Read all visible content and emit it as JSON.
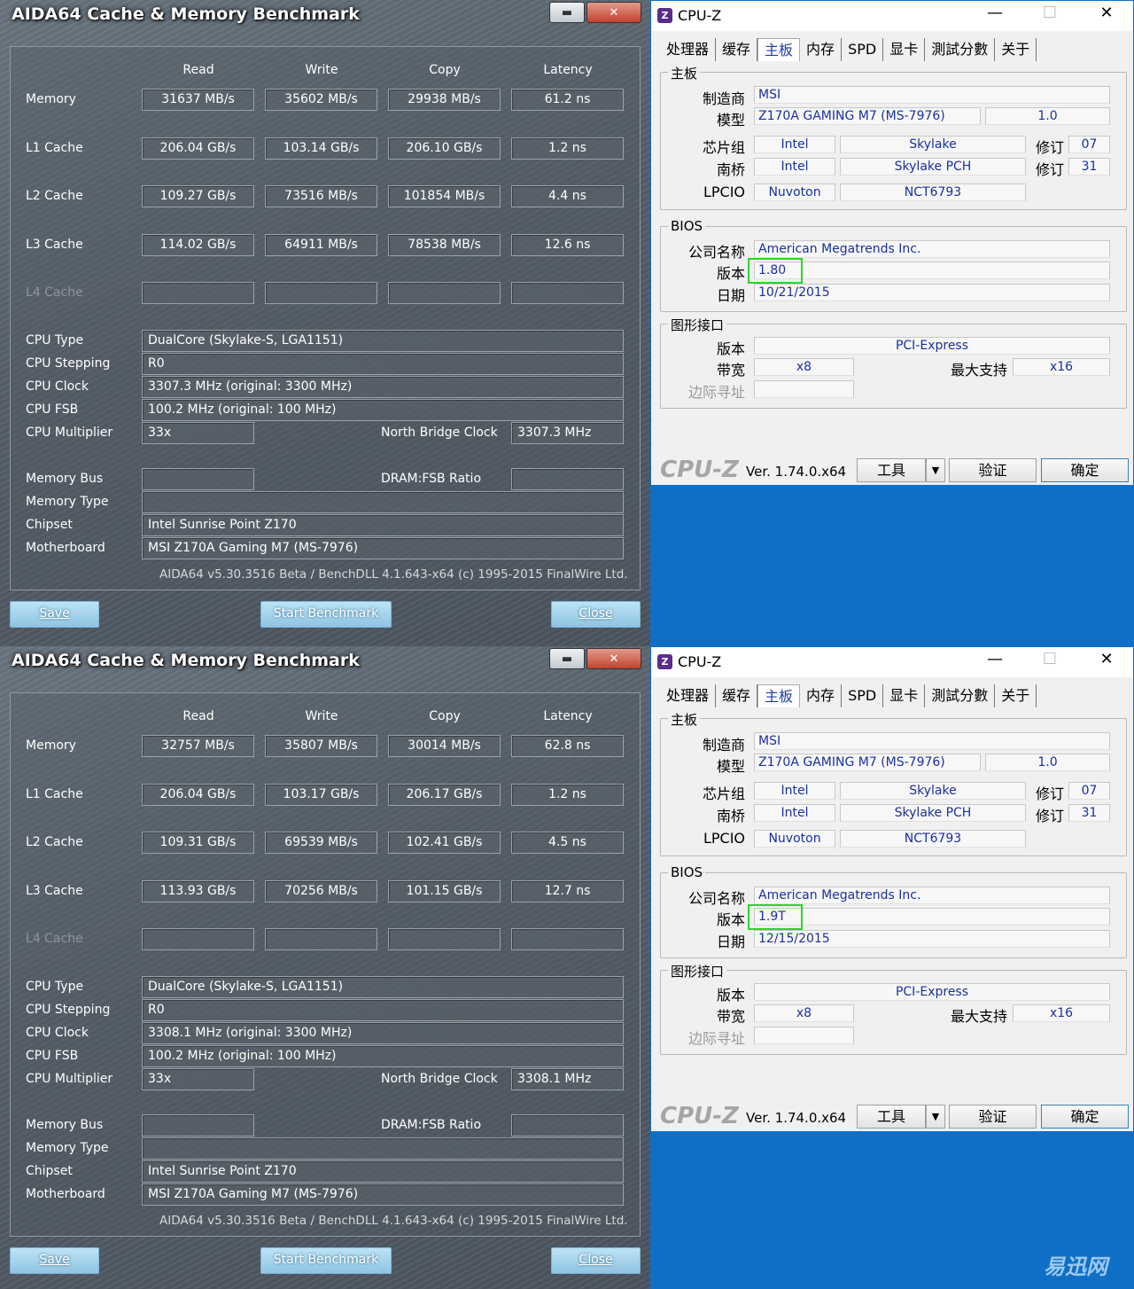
{
  "screens": [
    {
      "aida": {
        "title": "AIDA64 Cache & Memory Benchmark",
        "window_buttons": {
          "minimize": "▬",
          "close": "✕"
        },
        "columns": [
          "Read",
          "Write",
          "Copy",
          "Latency"
        ],
        "rows": [
          {
            "label": "Memory",
            "values": [
              "31637 MB/s",
              "35602 MB/s",
              "29938 MB/s",
              "61.2 ns"
            ]
          },
          {
            "label": "L1 Cache",
            "values": [
              "206.04 GB/s",
              "103.14 GB/s",
              "206.10 GB/s",
              "1.2 ns"
            ]
          },
          {
            "label": "L2 Cache",
            "values": [
              "109.27 GB/s",
              "73516 MB/s",
              "101854 MB/s",
              "4.4 ns"
            ]
          },
          {
            "label": "L3 Cache",
            "values": [
              "114.02 GB/s",
              "64911 MB/s",
              "78538 MB/s",
              "12.6 ns"
            ]
          },
          {
            "label": "L4 Cache",
            "values": [
              "",
              "",
              "",
              ""
            ]
          }
        ],
        "info": {
          "cpu_type_label": "CPU Type",
          "cpu_type": "DualCore   (Skylake-S, LGA1151)",
          "cpu_stepping_label": "CPU Stepping",
          "cpu_stepping": "R0",
          "cpu_clock_label": "CPU Clock",
          "cpu_clock": "3307.3 MHz  (original: 3300 MHz)",
          "cpu_fsb_label": "CPU FSB",
          "cpu_fsb": "100.2 MHz  (original: 100 MHz)",
          "cpu_multiplier_label": "CPU Multiplier",
          "cpu_multiplier": "33x",
          "nb_clock_label": "North Bridge Clock",
          "nb_clock": "3307.3 MHz",
          "memory_bus_label": "Memory Bus",
          "memory_bus": "",
          "dram_ratio_label": "DRAM:FSB Ratio",
          "dram_ratio": "",
          "memory_type_label": "Memory Type",
          "memory_type": "",
          "chipset_label": "Chipset",
          "chipset": "Intel Sunrise Point Z170",
          "motherboard_label": "Motherboard",
          "motherboard": "MSI Z170A Gaming M7 (MS-7976)"
        },
        "footer": "AIDA64 v5.30.3516 Beta / BenchDLL 4.1.643-x64  (c) 1995-2015 FinalWire Ltd.",
        "buttons": {
          "save": "Save",
          "start": "Start Benchmark",
          "close": "Close"
        }
      },
      "cpuz": {
        "title": "CPU-Z",
        "app_icon": "Z",
        "tabs": [
          "处理器",
          "缓存",
          "主板",
          "内存",
          "SPD",
          "显卡",
          "測試分數",
          "关于"
        ],
        "active_tab": 2,
        "mb_group": "主板",
        "manufacturer_label": "制造商",
        "manufacturer": "MSI",
        "model_label": "模型",
        "model": "Z170A GAMING M7 (MS-7976)",
        "model_rev": "1.0",
        "chipset_label": "芯片组",
        "chipset_vendor": "Intel",
        "chipset_name": "Skylake",
        "chipset_rev_label": "修订",
        "chipset_rev": "07",
        "southbridge_label": "南桥",
        "sb_vendor": "Intel",
        "sb_name": "Skylake PCH",
        "sb_rev_label": "修订",
        "sb_rev": "31",
        "lpcio_label": "LPCIO",
        "lpcio_vendor": "Nuvoton",
        "lpcio_name": "NCT6793",
        "bios_group": "BIOS",
        "bios_brand_label": "公司名称",
        "bios_brand": "American Megatrends Inc.",
        "bios_version_label": "版本",
        "bios_version": "1.80",
        "bios_date_label": "日期",
        "bios_date": "10/21/2015",
        "gfx_group": "图形接口",
        "gfx_version_label": "版本",
        "gfx_version": "PCI-Express",
        "gfx_width_label": "带宽",
        "gfx_width": "x8",
        "gfx_max_label": "最大支持",
        "gfx_max": "x16",
        "gfx_sideband_label": "边际寻址",
        "gfx_sideband": "",
        "logo": "CPU-Z",
        "version": "Ver. 1.74.0.x64",
        "tools_button": "工具",
        "validate_button": "验证",
        "ok_button": "确定"
      }
    },
    {
      "aida": {
        "title": "AIDA64 Cache & Memory Benchmark",
        "window_buttons": {
          "minimize": "▬",
          "close": "✕"
        },
        "columns": [
          "Read",
          "Write",
          "Copy",
          "Latency"
        ],
        "rows": [
          {
            "label": "Memory",
            "values": [
              "32757 MB/s",
              "35807 MB/s",
              "30014 MB/s",
              "62.8 ns"
            ]
          },
          {
            "label": "L1 Cache",
            "values": [
              "206.04 GB/s",
              "103.17 GB/s",
              "206.17 GB/s",
              "1.2 ns"
            ]
          },
          {
            "label": "L2 Cache",
            "values": [
              "109.31 GB/s",
              "69539 MB/s",
              "102.41 GB/s",
              "4.5 ns"
            ]
          },
          {
            "label": "L3 Cache",
            "values": [
              "113.93 GB/s",
              "70256 MB/s",
              "101.15 GB/s",
              "12.7 ns"
            ]
          },
          {
            "label": "L4 Cache",
            "values": [
              "",
              "",
              "",
              ""
            ]
          }
        ],
        "info": {
          "cpu_type_label": "CPU Type",
          "cpu_type": "DualCore   (Skylake-S, LGA1151)",
          "cpu_stepping_label": "CPU Stepping",
          "cpu_stepping": "R0",
          "cpu_clock_label": "CPU Clock",
          "cpu_clock": "3308.1 MHz  (original: 3300 MHz)",
          "cpu_fsb_label": "CPU FSB",
          "cpu_fsb": "100.2 MHz  (original: 100 MHz)",
          "cpu_multiplier_label": "CPU Multiplier",
          "cpu_multiplier": "33x",
          "nb_clock_label": "North Bridge Clock",
          "nb_clock": "3308.1 MHz",
          "memory_bus_label": "Memory Bus",
          "memory_bus": "",
          "dram_ratio_label": "DRAM:FSB Ratio",
          "dram_ratio": "",
          "memory_type_label": "Memory Type",
          "memory_type": "",
          "chipset_label": "Chipset",
          "chipset": "Intel Sunrise Point Z170",
          "motherboard_label": "Motherboard",
          "motherboard": "MSI Z170A Gaming M7 (MS-7976)"
        },
        "footer": "AIDA64 v5.30.3516 Beta / BenchDLL 4.1.643-x64  (c) 1995-2015 FinalWire Ltd.",
        "buttons": {
          "save": "Save",
          "start": "Start Benchmark",
          "close": "Close"
        }
      },
      "cpuz": {
        "title": "CPU-Z",
        "app_icon": "Z",
        "tabs": [
          "处理器",
          "缓存",
          "主板",
          "内存",
          "SPD",
          "显卡",
          "測試分數",
          "关于"
        ],
        "active_tab": 2,
        "mb_group": "主板",
        "manufacturer_label": "制造商",
        "manufacturer": "MSI",
        "model_label": "模型",
        "model": "Z170A GAMING M7 (MS-7976)",
        "model_rev": "1.0",
        "chipset_label": "芯片组",
        "chipset_vendor": "Intel",
        "chipset_name": "Skylake",
        "chipset_rev_label": "修订",
        "chipset_rev": "07",
        "southbridge_label": "南桥",
        "sb_vendor": "Intel",
        "sb_name": "Skylake PCH",
        "sb_rev_label": "修订",
        "sb_rev": "31",
        "lpcio_label": "LPCIO",
        "lpcio_vendor": "Nuvoton",
        "lpcio_name": "NCT6793",
        "bios_group": "BIOS",
        "bios_brand_label": "公司名称",
        "bios_brand": "American Megatrends Inc.",
        "bios_version_label": "版本",
        "bios_version": "1.9T",
        "bios_date_label": "日期",
        "bios_date": "12/15/2015",
        "gfx_group": "图形接口",
        "gfx_version_label": "版本",
        "gfx_version": "PCI-Express",
        "gfx_width_label": "带宽",
        "gfx_width": "x8",
        "gfx_max_label": "最大支持",
        "gfx_max": "x16",
        "gfx_sideband_label": "边际寻址",
        "gfx_sideband": "",
        "logo": "CPU-Z",
        "version": "Ver. 1.74.0.x64",
        "tools_button": "工具",
        "validate_button": "验证",
        "ok_button": "确定"
      }
    }
  ],
  "watermark": "易迅网",
  "colors": {
    "desktop": "#0f6fc6",
    "cpuz_value": "#1a2fa0",
    "cpuz_active_tab": "#1f3aa8",
    "bios_highlight": "#2bd52b"
  }
}
